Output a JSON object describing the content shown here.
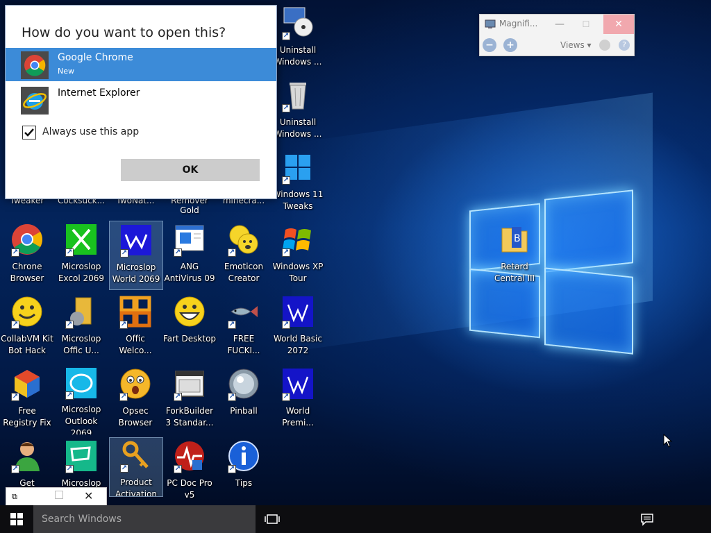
{
  "dialog": {
    "title": "How do you want to open this?",
    "apps": [
      {
        "name": "Google Chrome",
        "sub": "New"
      },
      {
        "name": "Internet Explorer",
        "sub": ""
      }
    ],
    "always_label": "Always use this app",
    "always_checked": true,
    "ok_label": "OK"
  },
  "magnifier": {
    "title": "Magnifi...",
    "views_label": "Views ▾",
    "zoom_out": "−",
    "zoom_in": "+",
    "help": "?"
  },
  "partial_labels": [
    "Tweaker",
    "Cocksuck...",
    "TwoNat...",
    "Remover Gold",
    "minecra..."
  ],
  "icons": [
    {
      "label": "Uninstall\nWindows ...",
      "icon": "disc-computer-icon"
    },
    {
      "label": "Uninstall\nWindows ...",
      "icon": "trash-can-icon"
    },
    {
      "label": "Windows 11\nTweaks",
      "icon": "windows-logo-icon"
    },
    {
      "label": "Chrone\nBrowser",
      "icon": "chrome-icon"
    },
    {
      "label": "Microslop\nExcol 2069",
      "icon": "excel-icon"
    },
    {
      "label": "Microslop\nWorld 2069",
      "icon": "word-icon"
    },
    {
      "label": "ANG\nAntiVirus 09",
      "icon": "antivirus-window-icon"
    },
    {
      "label": "Emoticon\nCreator",
      "icon": "emoticon-icon"
    },
    {
      "label": "Windows XP\nTour",
      "icon": "windows-xp-icon"
    },
    {
      "label": "Retard\nCentral III",
      "icon": "folder-book-icon"
    },
    {
      "label": "CollabVM Kit\nBot Hack",
      "icon": "smiley-icon"
    },
    {
      "label": "Microslop\nOffic U...",
      "icon": "office-update-icon"
    },
    {
      "label": "Offic\nWelco...",
      "icon": "office-logo-icon"
    },
    {
      "label": "Fart Desktop",
      "icon": "grin-icon"
    },
    {
      "label": "FREE\nFUCKI...",
      "icon": "fish-icon"
    },
    {
      "label": "World Basic\n2072",
      "icon": "word-basic-icon"
    },
    {
      "label": "Free\nRegistry Fix",
      "icon": "registry-cube-icon"
    },
    {
      "label": "Microslop\nOutlook 2069",
      "icon": "outlook-icon"
    },
    {
      "label": "Opsec\nBrowser",
      "icon": "shocked-face-icon"
    },
    {
      "label": "ForkBuilder\n3 Standar...",
      "icon": "window-app-icon"
    },
    {
      "label": "Pinball",
      "icon": "pinball-icon"
    },
    {
      "label": "World\nPremi...",
      "icon": "word-premium-icon"
    },
    {
      "label": "Get",
      "icon": "user-help-icon"
    },
    {
      "label": "Microslop",
      "icon": "publisher-icon"
    },
    {
      "label": "Product\nActivation",
      "icon": "key-icon"
    },
    {
      "label": "PC Doc Pro\nv5",
      "icon": "pc-doctor-icon"
    },
    {
      "label": "Tips",
      "icon": "info-icon"
    }
  ],
  "taskbar": {
    "search_placeholder": "Search Windows"
  },
  "mini_window": {
    "close": "✕"
  }
}
